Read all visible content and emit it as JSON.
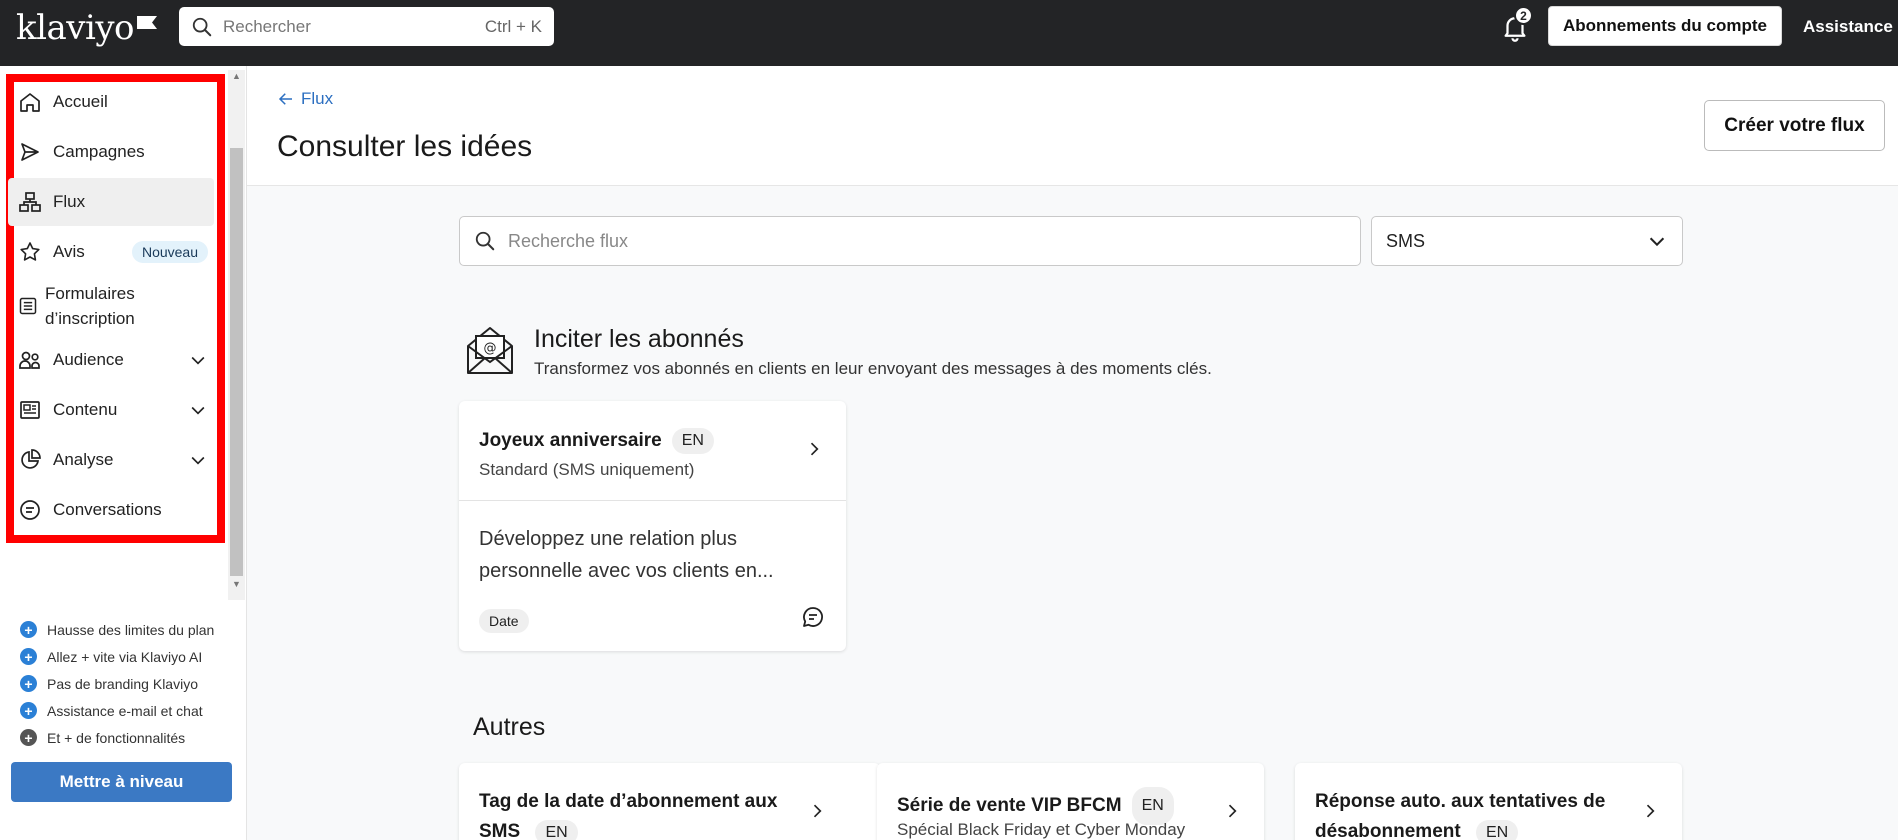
{
  "topbar": {
    "logo": "klaviyo",
    "search_placeholder": "Rechercher",
    "search_shortcut": "Ctrl + K",
    "notification_count": "2",
    "account_button": "Abonnements du compte",
    "assistance": "Assistance"
  },
  "sidebar": {
    "items": [
      {
        "label": "Accueil"
      },
      {
        "label": "Campagnes"
      },
      {
        "label": "Flux"
      },
      {
        "label": "Avis",
        "badge": "Nouveau"
      },
      {
        "label_line1": "Formulaires",
        "label_line2": "d’inscription"
      },
      {
        "label": "Audience"
      },
      {
        "label": "Contenu"
      },
      {
        "label": "Analyse"
      },
      {
        "label": "Conversations"
      }
    ],
    "upsell": [
      "Hausse des limites du plan",
      "Allez + vite via Klaviyo AI",
      "Pas de branding Klaviyo",
      "Assistance e-mail et chat",
      "Et + de fonctionnalités"
    ],
    "upgrade_button": "Mettre à niveau"
  },
  "header": {
    "back_label": "Flux",
    "title": "Consulter les idées",
    "create_button": "Créer votre flux"
  },
  "filters": {
    "search_placeholder": "Recherche flux",
    "channel_selected": "SMS"
  },
  "section": {
    "title": "Inciter les abonnés",
    "subtitle": "Transformez vos abonnés en clients en leur envoyant des messages à des moments clés."
  },
  "featured_card": {
    "title": "Joyeux anniversaire",
    "lang": "EN",
    "subtitle": "Standard (SMS uniquement)",
    "desc_line1": "Développez une relation plus",
    "desc_line2": "personnelle avec vos clients en...",
    "tag": "Date"
  },
  "others": {
    "title": "Autres",
    "cards": [
      {
        "line1": "Tag de la date d’abonnement aux",
        "line2": "SMS",
        "lang": "EN"
      },
      {
        "title": "Série de vente VIP BFCM",
        "lang": "EN",
        "subtitle": "Spécial Black Friday et Cyber Monday"
      },
      {
        "line1": "Réponse auto. aux tentatives de",
        "line2": "désabonnement",
        "lang": "EN"
      }
    ]
  },
  "colors": {
    "topbar": "#232426",
    "accent_blue": "#2c6fc1",
    "upgrade_blue": "#3b79c4",
    "highlight_red": "#ff0000"
  }
}
